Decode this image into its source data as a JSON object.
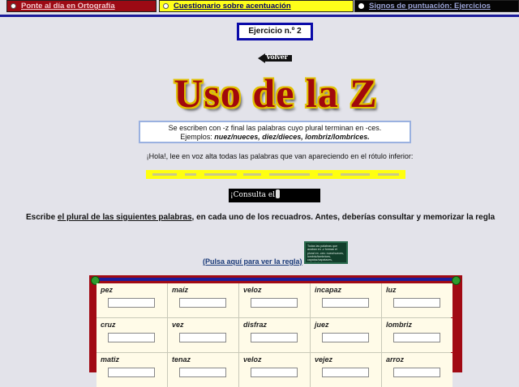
{
  "nav": {
    "tab1": "Ponte al día en Ortografía",
    "tab2": "Cuestionario sobre acentuación",
    "tab3": "Signos de puntuación: Ejercicios"
  },
  "exercise_label": "Ejercicio n.º 2",
  "back_label": "Volver",
  "title": "Uso de la Z",
  "rule": {
    "line1": "Se escriben con -z final las palabras cuyo plural terminan en -ces.",
    "examples_label": "Ejemplos: ",
    "examples": "nuez/nueces, diez/dieces, lombriz/lombrices."
  },
  "instruction": "¡Hola!, lee en voz alta todas las palabras que van apareciendo en el rótulo inferior:",
  "consult_button": "¡Consulta el",
  "task": {
    "part1": "Escribe ",
    "part2": "el plural de las siguientes palabras",
    "part3": ", en cada uno de los recuadros. Antes, deberías consultar y memorizar la regla"
  },
  "chalkboard_text": "Todas las palabras que acaban en -z forman el plural en -ces: nuez/nueces, lombriz/lombrices, capataz/capataces, vejez/vejeces.",
  "rule_link": "(Pulsa aquí para ver la regla)",
  "words": [
    [
      "pez",
      "maíz",
      "veloz",
      "incapaz",
      "luz"
    ],
    [
      "cruz",
      "vez",
      "disfraz",
      "juez",
      "lombriz"
    ],
    [
      "matiz",
      "tenaz",
      "veloz",
      "vejez",
      "arroz"
    ]
  ],
  "colors": {
    "tab1": "#9c0a14",
    "tab2": "#ffff1a",
    "tab3": "#050505",
    "title": "#a1080c",
    "board": "#a10a14"
  }
}
